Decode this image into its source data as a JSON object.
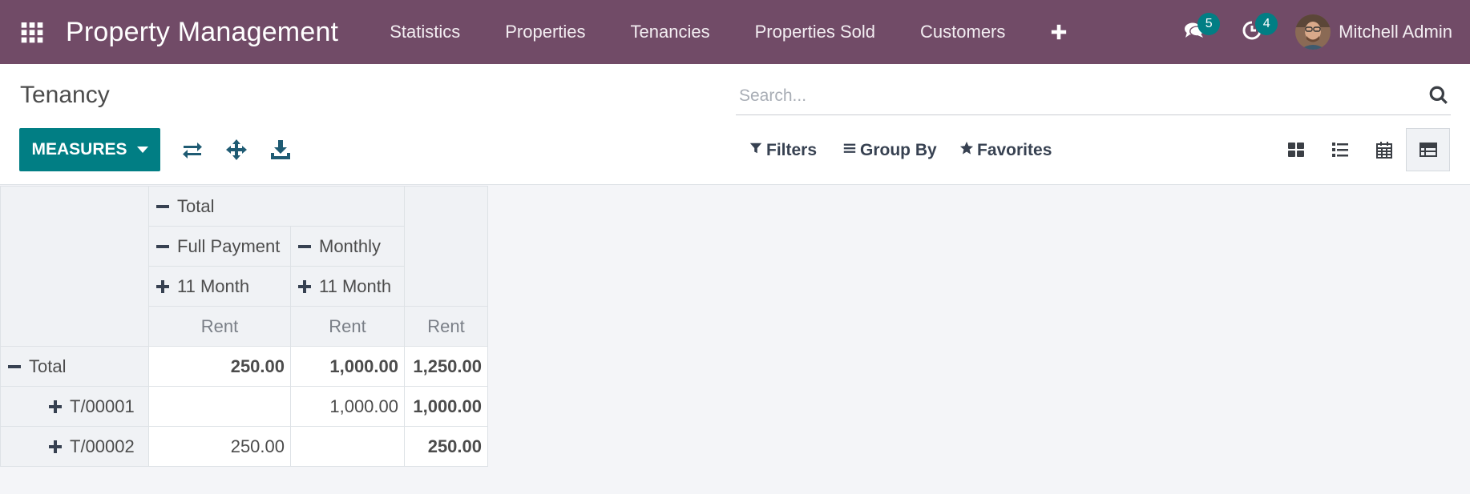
{
  "navbar": {
    "brand": "Property Management",
    "menu": [
      {
        "id": "statistics",
        "label": "Statistics"
      },
      {
        "id": "properties",
        "label": "Properties"
      },
      {
        "id": "tenancies",
        "label": "Tenancies"
      },
      {
        "id": "properties-sold",
        "label": "Properties Sold"
      },
      {
        "id": "customers",
        "label": "Customers"
      }
    ],
    "messages_count": "5",
    "activities_count": "4",
    "user_name": "Mitchell Admin",
    "color": "#714b67"
  },
  "control_panel": {
    "title": "Tenancy",
    "search_placeholder": "Search...",
    "measures_label": "MEASURES",
    "filters_label": "Filters",
    "groupby_label": "Group By",
    "favorites_label": "Favorites",
    "accent_color": "#017e84"
  },
  "pivot": {
    "col_total": "Total",
    "col_groups": [
      "Full Payment",
      "Monthly"
    ],
    "col_subgroups": [
      "11 Month",
      "11 Month"
    ],
    "measure": "Rent",
    "rows": [
      {
        "label": "Total",
        "values": [
          "250.00",
          "1,000.00",
          "1,250.00"
        ]
      },
      {
        "label": "T/00001",
        "values": [
          "",
          "1,000.00",
          "1,000.00"
        ]
      },
      {
        "label": "T/00002",
        "values": [
          "250.00",
          "",
          "250.00"
        ]
      }
    ]
  }
}
